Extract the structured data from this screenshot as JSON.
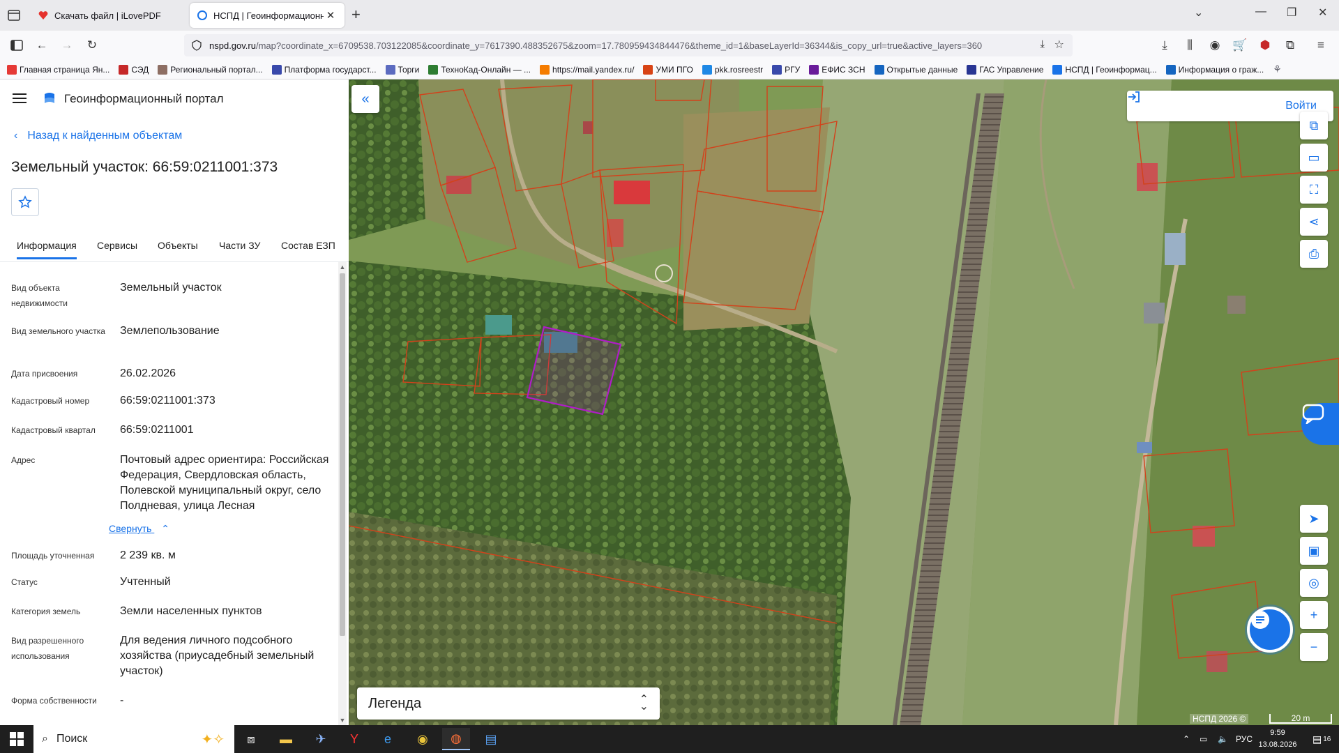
{
  "browser": {
    "tabs": [
      {
        "title": "Скачать файл | iLovePDF",
        "active": false
      },
      {
        "title": "НСПД | Геоинформационный",
        "active": true
      }
    ],
    "url_host": "nspd.gov.ru",
    "url_rest": "/map?coordinate_x=6709538.703122085&coordinate_y=7617390.488352675&zoom=17.780959434844476&theme_id=1&baseLayerId=36344&is_copy_url=true&active_layers=360",
    "bookmarks": [
      {
        "label": "Главная страница Ян...",
        "color": "#e53935"
      },
      {
        "label": "СЭД",
        "color": "#c62828"
      },
      {
        "label": "Региональный портал...",
        "color": "#8d6e63"
      },
      {
        "label": "Платформа государст...",
        "color": "#3949ab"
      },
      {
        "label": "Торги",
        "color": "#5c6bc0"
      },
      {
        "label": "ТехноКад-Онлайн — ...",
        "color": "#2e7d32"
      },
      {
        "label": "https://mail.yandex.ru/",
        "color": "#f57c00"
      },
      {
        "label": "УМИ ПГО",
        "color": "#d84315"
      },
      {
        "label": "pkk.rosreestr",
        "color": "#1e88e5"
      },
      {
        "label": "РГУ",
        "color": "#3949ab"
      },
      {
        "label": "ЕФИС ЗСН",
        "color": "#6a1b9a"
      },
      {
        "label": "Открытые данные",
        "color": "#1565c0"
      },
      {
        "label": "ГАС Управление",
        "color": "#283593"
      },
      {
        "label": "НСПД | Геоинформац...",
        "color": "#1a73e8"
      },
      {
        "label": "Информация о граж...",
        "color": "#1565c0"
      }
    ]
  },
  "panel": {
    "portal_title": "Геоинформационный портал",
    "back_link": "Назад к найденным объектам",
    "object_title": "Земельный участок: 66:59:0211001:373",
    "tabs": [
      "Информация",
      "Сервисы",
      "Объекты",
      "Части ЗУ",
      "Состав ЕЗП"
    ],
    "properties": [
      {
        "label": "Вид объекта недвижимости",
        "value": "Земельный участок"
      },
      {
        "label": "Вид земельного участка",
        "value": "Землепользование"
      },
      {
        "label": "Дата присвоения",
        "value": "26.02.2026"
      },
      {
        "label": "Кадастровый номер",
        "value": "66:59:0211001:373"
      },
      {
        "label": "Кадастровый квартал",
        "value": "66:59:0211001"
      },
      {
        "label": "Адрес",
        "value": "Почтовый адрес ориентира: Российская Федерация, Свердловская область, Полевской муниципальный округ, село Полдневая, улица Лесная"
      },
      {
        "label": "Площадь уточненная",
        "value": "2 239 кв. м"
      },
      {
        "label": "Статус",
        "value": "Учтенный"
      },
      {
        "label": "Категория земель",
        "value": "Земли населенных пунктов"
      },
      {
        "label": "Вид разрешенного использования",
        "value": "Для ведения личного подсобного хозяйства (приусадебный земельный участок)"
      },
      {
        "label": "Форма собственности",
        "value": "-"
      }
    ],
    "collapse_label": "Свернуть"
  },
  "map": {
    "login_label": "Войти",
    "legend_label": "Легенда",
    "copyright": "НСПД 2026 ©",
    "scale_label": "20 m",
    "selected_parcel_color": "#b01cc8",
    "parcel_border_color": "#d2421b"
  },
  "taskbar": {
    "search_placeholder": "Поиск",
    "language": "РУС",
    "time": "9:59",
    "date": "13.08.2026",
    "notifications": "16"
  }
}
